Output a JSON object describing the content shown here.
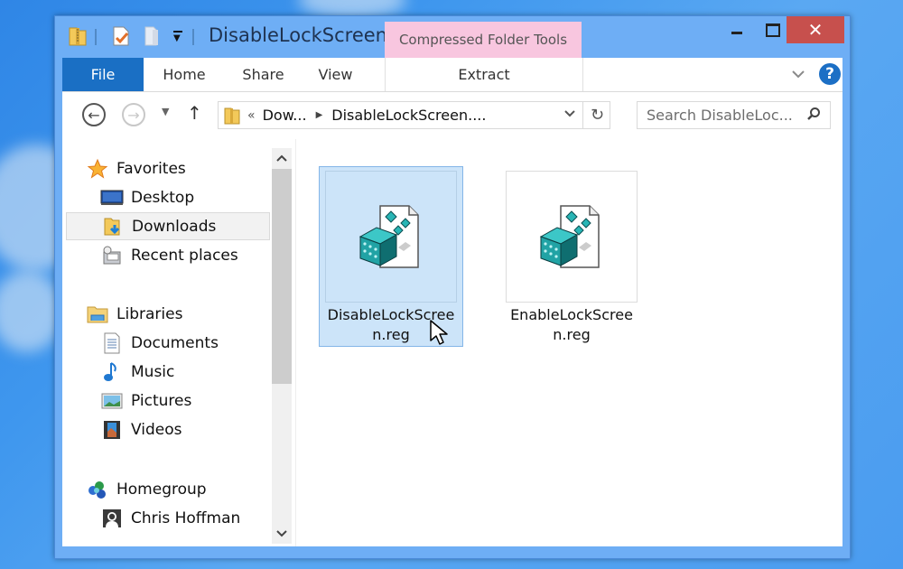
{
  "window": {
    "title": "DisableLockScreen...",
    "contextual_tab_group": "Compressed Folder Tools",
    "controls": {
      "minimize": "minimize",
      "maximize": "maximize",
      "close": "✕"
    }
  },
  "quick_access": {
    "icons": [
      "zip-folder-icon",
      "properties-icon",
      "new-folder-icon",
      "customize-dropdown-icon"
    ]
  },
  "ribbon": {
    "tabs": [
      {
        "label": "File",
        "active": true
      },
      {
        "label": "Home"
      },
      {
        "label": "Share"
      },
      {
        "label": "View"
      },
      {
        "label": "Extract"
      }
    ],
    "expand_glyph": "⌄",
    "help_glyph": "?"
  },
  "navigation": {
    "back_glyph": "←",
    "forward_glyph": "→",
    "recent_glyph": "▼",
    "up_glyph": "↑",
    "address": {
      "overflow": "«",
      "segments": [
        "Dow...",
        "DisableLockScreen...."
      ],
      "separator": "▶",
      "dropdown_glyph": "⌄",
      "refresh_glyph": "↻"
    },
    "search": {
      "placeholder": "Search DisableLoc...",
      "icon_glyph": "⚲"
    }
  },
  "nav_pane": {
    "groups": [
      {
        "label": "Favorites",
        "icon": "star-icon",
        "items": [
          {
            "label": "Desktop",
            "icon": "desktop-icon"
          },
          {
            "label": "Downloads",
            "icon": "downloads-icon",
            "selected": true
          },
          {
            "label": "Recent places",
            "icon": "recent-places-icon"
          }
        ]
      },
      {
        "label": "Libraries",
        "icon": "libraries-icon",
        "items": [
          {
            "label": "Documents",
            "icon": "documents-icon"
          },
          {
            "label": "Music",
            "icon": "music-icon"
          },
          {
            "label": "Pictures",
            "icon": "pictures-icon"
          },
          {
            "label": "Videos",
            "icon": "videos-icon"
          }
        ]
      },
      {
        "label": "Homegroup",
        "icon": "homegroup-icon",
        "items": [
          {
            "label": "Chris Hoffman",
            "icon": "user-icon"
          }
        ]
      }
    ],
    "scroll_up_glyph": "^",
    "scroll_down_glyph": "⌄"
  },
  "files": [
    {
      "name": "DisableLockScreen.reg",
      "line1": "DisableLockScree",
      "line2": "n.reg",
      "type": "registry-file",
      "selected": true
    },
    {
      "name": "EnableLockScreen.reg",
      "line1": "EnableLockScree",
      "line2": "n.reg",
      "type": "registry-file",
      "selected": false
    }
  ],
  "colors": {
    "title_bar": "#6eaef5",
    "file_tab": "#1a6fc4",
    "contextual_tab": "#f8c6df",
    "close_button": "#c7504d",
    "selection": "#cce4f9",
    "selection_border": "#84b6e8"
  }
}
